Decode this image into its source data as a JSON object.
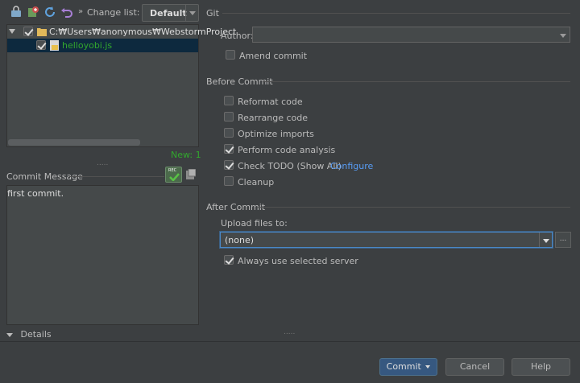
{
  "toolbar": {
    "change_list_label": "Change list:",
    "change_list_value": "Default",
    "icons": [
      "vcs-refresh-icon",
      "commit-icon",
      "refresh-icon",
      "revert-icon"
    ]
  },
  "tree": {
    "root_path": "C:₩Users₩anonymous₩WebstormProject",
    "file_name": "helloyobi.js",
    "new_count": "New: 1"
  },
  "commit_message": {
    "label": "Commit Message",
    "text": "first commit."
  },
  "details": {
    "label": "Details"
  },
  "git": {
    "title": "Git",
    "author_label": "Author:",
    "author_value": "",
    "amend_label": "Amend commit"
  },
  "before_commit": {
    "title": "Before Commit",
    "options": [
      {
        "label": "Reformat code",
        "checked": false
      },
      {
        "label": "Rearrange code",
        "checked": false
      },
      {
        "label": "Optimize imports",
        "checked": false
      },
      {
        "label": "Perform code analysis",
        "checked": true
      },
      {
        "label": "Check TODO (Show All)",
        "checked": true,
        "link": "Configure"
      },
      {
        "label": "Cleanup",
        "checked": false
      }
    ]
  },
  "after_commit": {
    "title": "After Commit",
    "upload_label": "Upload files to:",
    "upload_value": "(none)",
    "browse_label": "...",
    "always_use_label": "Always use selected server",
    "always_use_checked": true
  },
  "buttons": {
    "commit": "Commit",
    "cancel": "Cancel",
    "help": "Help"
  },
  "colors": {
    "background": "#3c3f41",
    "panel": "#45494a",
    "primary_button": "#365880",
    "link": "#589df6",
    "new_file": "#32a82d"
  }
}
